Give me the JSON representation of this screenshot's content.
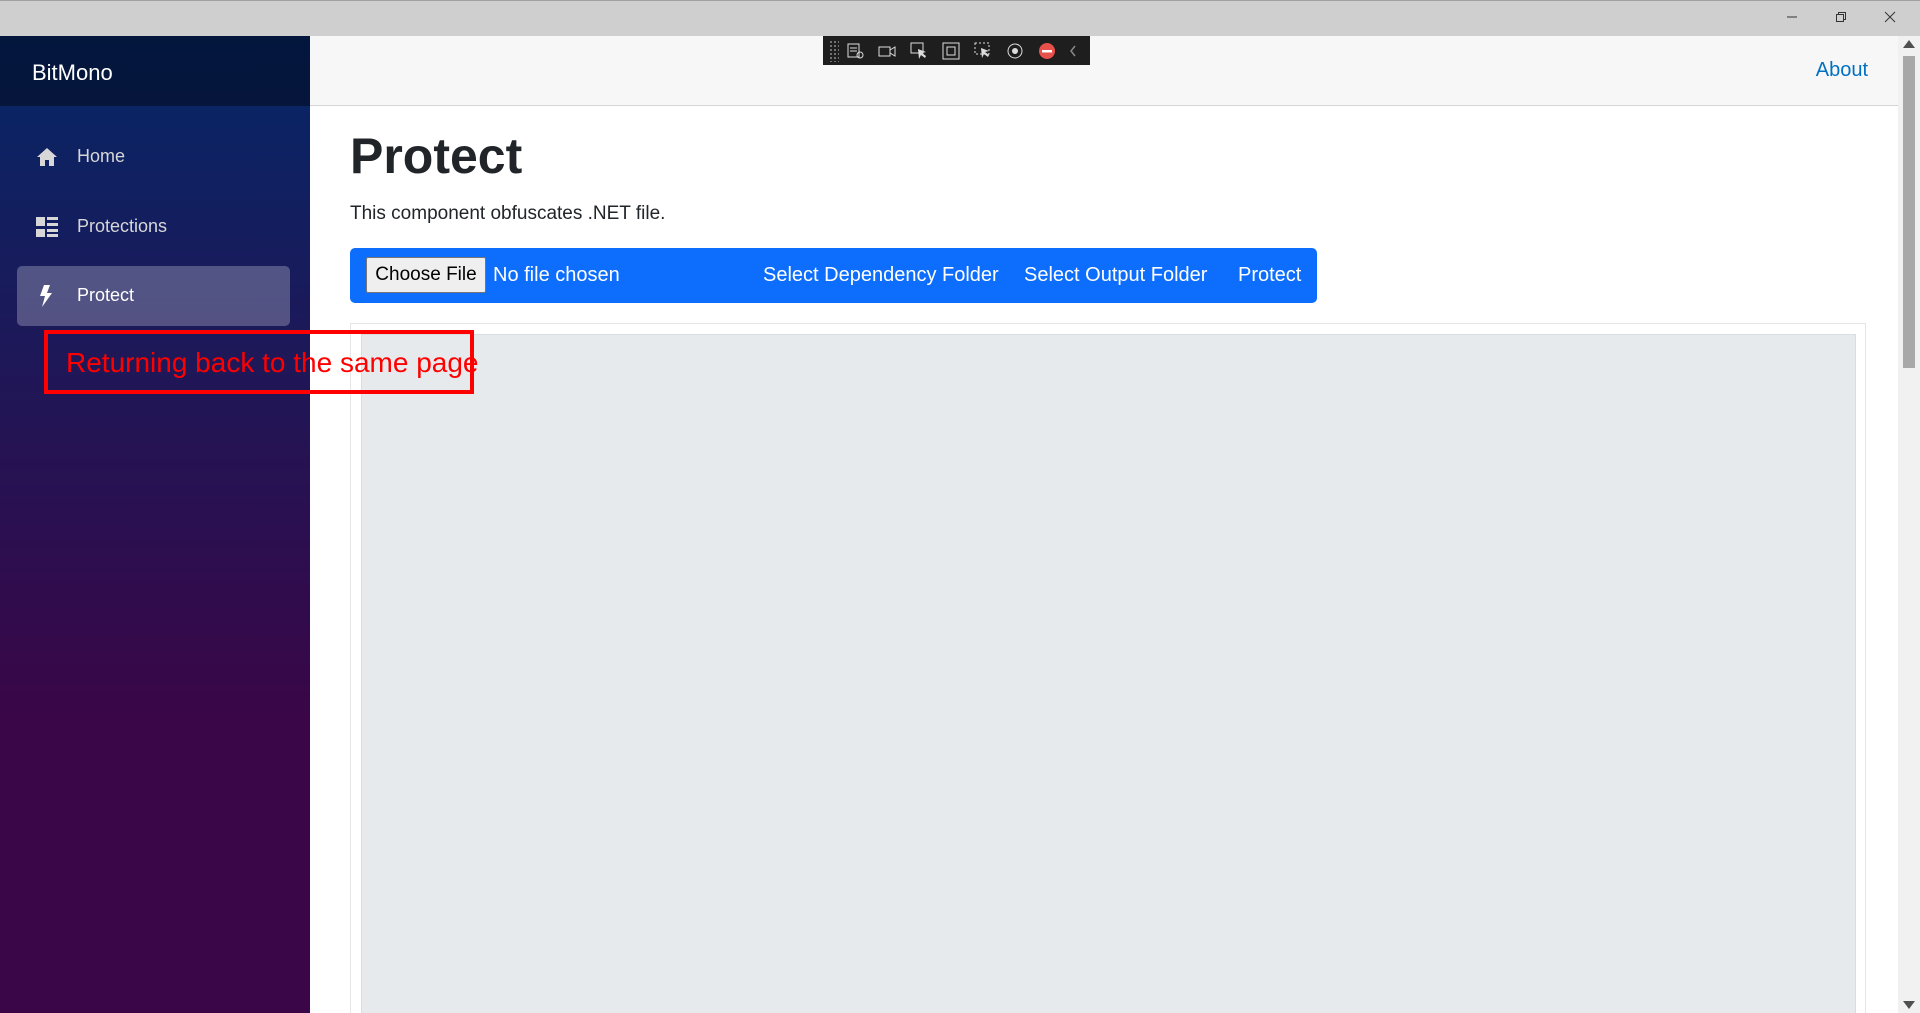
{
  "window": {
    "minimize_icon": "minimize-icon",
    "maximize_icon": "restore-icon",
    "close_icon": "close-icon"
  },
  "sidebar": {
    "brand": "BitMono",
    "items": [
      {
        "label": "Home",
        "icon": "home-icon"
      },
      {
        "label": "Protections",
        "icon": "list-icon"
      },
      {
        "label": "Protect",
        "icon": "bolt-icon",
        "active": true
      }
    ]
  },
  "header": {
    "about": "About"
  },
  "page": {
    "title": "Protect",
    "description": "This component obfuscates .NET file."
  },
  "actions": {
    "choose_file": "Choose File",
    "file_status": "No file chosen",
    "select_dependency": "Select Dependency Folder",
    "select_output": "Select Output Folder",
    "protect": "Protect"
  },
  "annotation": {
    "text": "Returning back to the same page",
    "color": "#ff0000"
  },
  "colors": {
    "accent": "#0d6efd",
    "link": "#0071c1"
  }
}
